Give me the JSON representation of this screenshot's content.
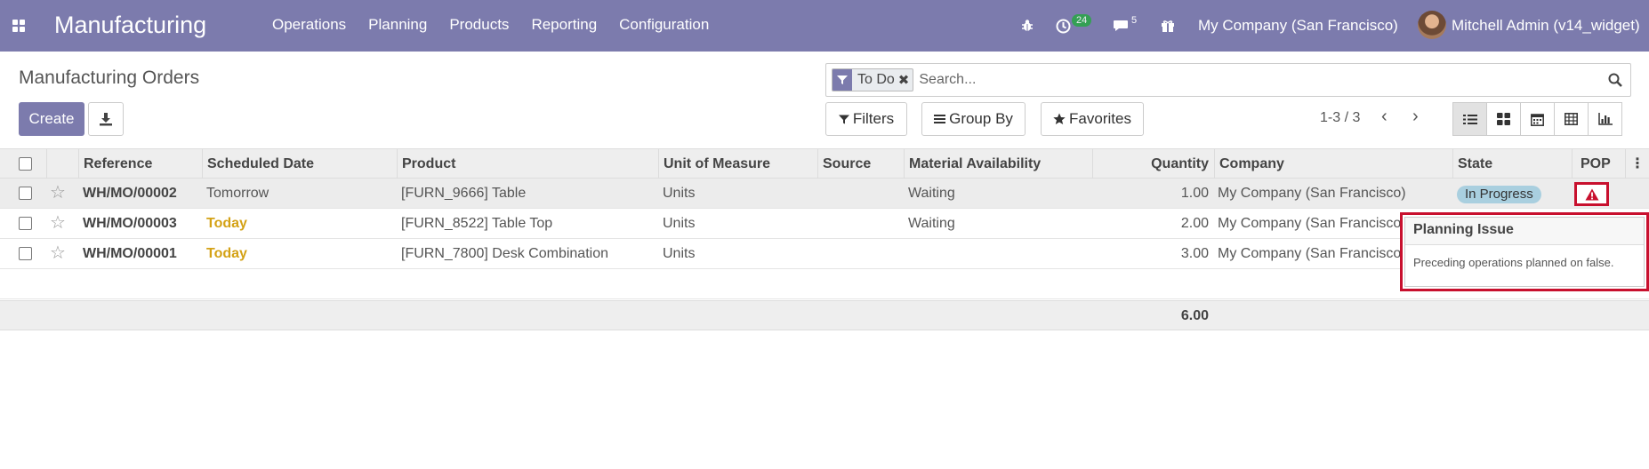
{
  "navbar": {
    "app_title": "Manufacturing",
    "menu": [
      "Operations",
      "Planning",
      "Products",
      "Reporting",
      "Configuration"
    ],
    "activity_count": "24",
    "message_count": "5",
    "company": "My Company (San Francisco)",
    "user": "Mitchell Admin (v14_widget)"
  },
  "control": {
    "breadcrumb": "Manufacturing Orders",
    "create_label": "Create",
    "search": {
      "facet_label": "To Do",
      "placeholder": "Search..."
    },
    "filters_label": "Filters",
    "groupby_label": "Group By",
    "favorites_label": "Favorites",
    "pager": "1-3 / 3"
  },
  "table": {
    "headers": {
      "reference": "Reference",
      "scheduled_date": "Scheduled Date",
      "product": "Product",
      "uom": "Unit of Measure",
      "source": "Source",
      "availability": "Material Availability",
      "quantity": "Quantity",
      "company": "Company",
      "state": "State",
      "pop": "POP"
    },
    "rows": [
      {
        "reference": "WH/MO/00002",
        "scheduled_date": "Tomorrow",
        "product": "[FURN_9666] Table",
        "uom": "Units",
        "source": "",
        "availability": "Waiting",
        "quantity": "1.00",
        "company": "My Company (San Francisco)",
        "state": "In Progress"
      },
      {
        "reference": "WH/MO/00003",
        "scheduled_date": "Today",
        "product": "[FURN_8522] Table Top",
        "uom": "Units",
        "source": "",
        "availability": "Waiting",
        "quantity": "2.00",
        "company": "My Company (San Francisco)",
        "state": ""
      },
      {
        "reference": "WH/MO/00001",
        "scheduled_date": "Today",
        "product": "[FURN_7800] Desk Combination",
        "uom": "Units",
        "source": "",
        "availability": "",
        "quantity": "3.00",
        "company": "My Company (San Francisco)",
        "state": ""
      }
    ],
    "total_quantity": "6.00"
  },
  "popover": {
    "title": "Planning Issue",
    "body": "Preceding operations planned on false."
  },
  "colors": {
    "brand": "#7c7bad",
    "today": "#d4a216",
    "warning": "#c8102e",
    "state_badge": "#a9cfdf"
  }
}
